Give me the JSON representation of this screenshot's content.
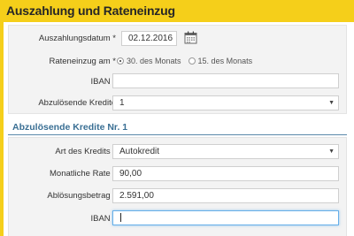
{
  "header": {
    "title": "Auszahlung und Rateneinzug"
  },
  "panel1": {
    "auszahlungsdatum": {
      "label": "Auszahlungsdatum *",
      "value": "02.12.2016"
    },
    "rateneinzug": {
      "label": "Rateneinzug am *",
      "options": [
        "30. des Monats",
        "15. des Monats"
      ],
      "selected": "30. des Monats"
    },
    "iban": {
      "label": "IBAN *",
      "value": ""
    },
    "abzuloesende_kredite": {
      "label": "Abzulösende Kredite",
      "value": "1"
    }
  },
  "section": {
    "title": "Abzulösende Kredite Nr. 1"
  },
  "panel2": {
    "art_des_kredits": {
      "label": "Art des Kredits *",
      "value": "Autokredit"
    },
    "monatliche_rate": {
      "label": "Monatliche Rate *",
      "value": "90,00"
    },
    "abloesungsbetrag": {
      "label": "Ablösungsbetrag *",
      "value": "2.591,00"
    },
    "iban": {
      "label": "IBAN *",
      "value": ""
    }
  },
  "icons": {
    "calendar": "calendar-icon",
    "select": "chevron-down-icon"
  },
  "colors": {
    "header": "#f5cf1a",
    "section_title": "#3a6f94",
    "focus": "#66afe9"
  }
}
